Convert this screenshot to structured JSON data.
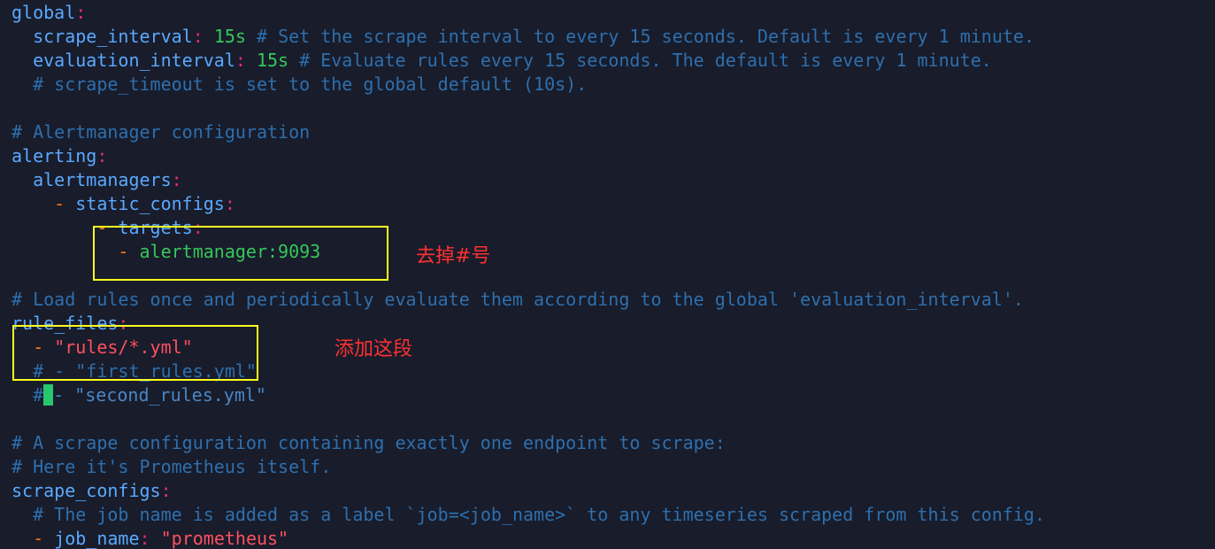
{
  "colors": {
    "background": "#181c2b",
    "key": "#5aa9ff",
    "colon": "#e0306a",
    "dash": "#ff7a1a",
    "number": "#34c85a",
    "comment": "#2e6fad",
    "string": "#ff5060",
    "annotation_box": "#ffff20",
    "annotation_text": "#ff3030",
    "cursor": "#26c76e"
  },
  "code": {
    "global_key": "global",
    "scrape_interval_key": "scrape_interval",
    "scrape_interval_value": "15s",
    "scrape_interval_comment": "# Set the scrape interval to every 15 seconds. Default is every 1 minute.",
    "evaluation_interval_key": "evaluation_interval",
    "evaluation_interval_value": "15s",
    "evaluation_interval_comment": "# Evaluate rules every 15 seconds. The default is every 1 minute.",
    "scrape_timeout_comment": "# scrape_timeout is set to the global default (10s).",
    "alertmanager_comment": "# Alertmanager configuration",
    "alerting_key": "alerting",
    "alertmanagers_key": "alertmanagers",
    "static_configs_key": "static_configs",
    "targets_key": "targets",
    "alertmanager_target": "alertmanager:9093",
    "load_rules_comment": "# Load rules once and periodically evaluate them according to the global 'evaluation_interval'.",
    "rule_files_key": "rule_files",
    "rules_glob": "\"rules/*.yml\"",
    "first_rules_comment": "# - \"first_rules.yml\"",
    "second_rules_hash": "#",
    "second_rules_rest": "- \"second_rules.yml\"",
    "scrape_config_comment_1": "# A scrape configuration containing exactly one endpoint to scrape:",
    "scrape_config_comment_2": "# Here it's Prometheus itself.",
    "scrape_configs_key": "scrape_configs",
    "job_name_comment": "# The job name is added as a label `job=<job_name>` to any timeseries scraped from this config.",
    "job_name_key": "job_name",
    "job_name_value": "\"prometheus\"",
    "colon": ":",
    "dash": "-"
  },
  "annotations": {
    "remove_hash_note": "去掉#号",
    "add_section_note": "添加这段"
  }
}
